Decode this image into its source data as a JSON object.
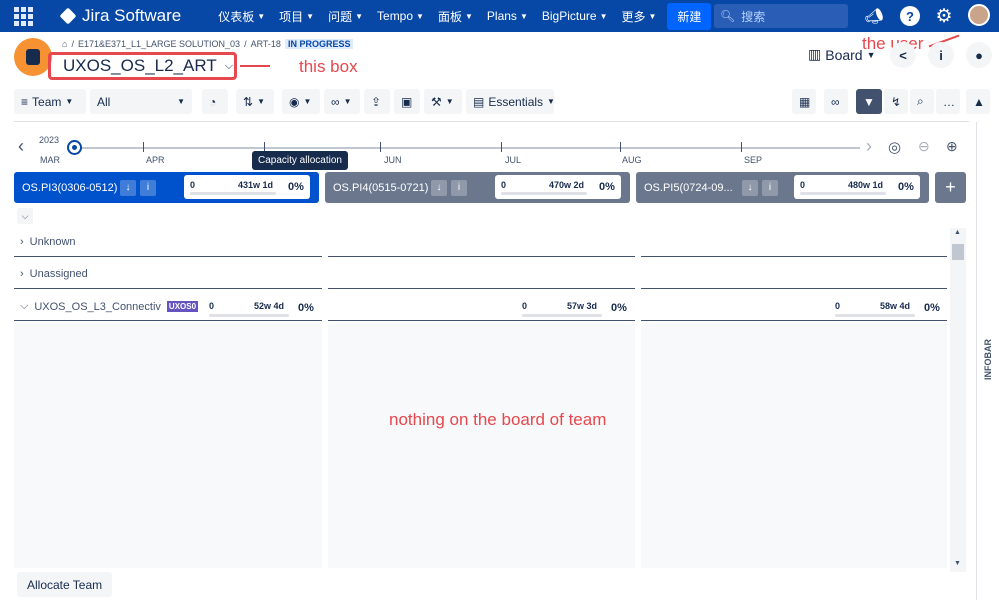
{
  "topnav": {
    "app_name": "Jira Software",
    "items": [
      "仪表板",
      "项目",
      "问题",
      "Tempo",
      "面板",
      "Plans",
      "BigPicture",
      "更多"
    ],
    "create_label": "新建",
    "search_placeholder": "搜索"
  },
  "header": {
    "breadcrumb_project": "E171&E371_L1_LARGE SOLUTION_03",
    "breadcrumb_key": "ART-18",
    "status": "IN PROGRESS",
    "title": "UXOS_OS_L2_ART",
    "board_label": "Board"
  },
  "annotations": {
    "title_box": "this box",
    "user": "the user",
    "empty_board": "nothing on the board of team"
  },
  "toolbar": {
    "team_label": "Team",
    "filter_value": "All",
    "essentials_label": "Essentials"
  },
  "timeline": {
    "year": "2023",
    "months": [
      "MAR",
      "APR",
      "JUN",
      "JUL",
      "AUG",
      "SEP"
    ],
    "tooltip": "Capacity allocation"
  },
  "increments": [
    {
      "name": "OS.PI3(0306-0512)",
      "min": "0",
      "capacity": "431w 1d",
      "percent": "0%"
    },
    {
      "name": "OS.PI4(0515-0721)",
      "min": "0",
      "capacity": "470w 2d",
      "percent": "0%"
    },
    {
      "name": "OS.PI5(0724-09...",
      "min": "0",
      "capacity": "480w 1d",
      "percent": "0%"
    }
  ],
  "rows": {
    "unknown": "Unknown",
    "unassigned": "Unassigned",
    "team_name": "UXOS_OS_L3_Connectiv",
    "team_badge": "UXOS0",
    "team_capacity": [
      {
        "min": "0",
        "capacity": "52w 4d",
        "percent": "0%"
      },
      {
        "min": "0",
        "capacity": "57w 3d",
        "percent": "0%"
      },
      {
        "min": "0",
        "capacity": "58w 4d",
        "percent": "0%"
      }
    ]
  },
  "infobar": "INFOBAR",
  "allocate_label": "Allocate Team",
  "colors": {
    "nav": "#0747a6",
    "active_pi": "#0052cc",
    "inactive_pi": "#6b778c",
    "annotation": "#e5484d"
  }
}
